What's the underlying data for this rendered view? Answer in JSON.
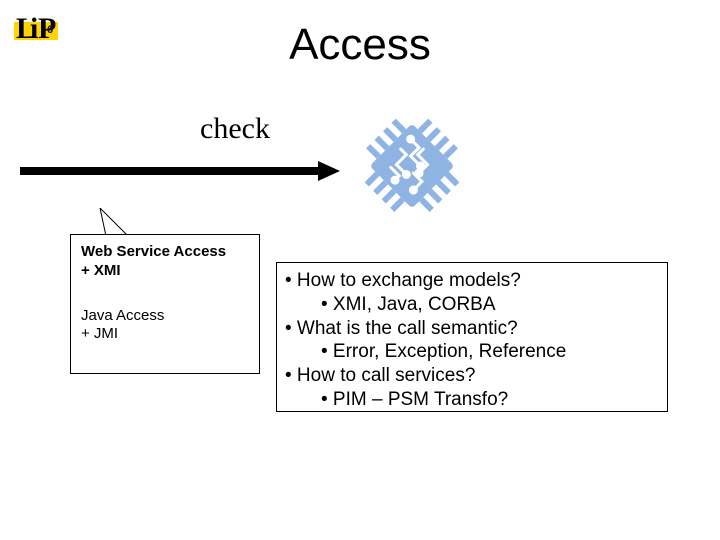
{
  "logo": {
    "letters": "LiP",
    "badge": "6"
  },
  "title": "Access",
  "arrow_label": "check",
  "access_box": {
    "ws_line1": "Web Service Access",
    "ws_line2": "+ XMI",
    "java_line1": "Java Access",
    "java_line2": "+ JMI"
  },
  "questions": {
    "q1": "• How to exchange models?",
    "q1a": "• XMI, Java, CORBA",
    "q2": "• What is the call semantic?",
    "q2a": "• Error, Exception, Reference",
    "q3": "• How to call services?",
    "q3a": "• PIM – PSM Transfo?"
  }
}
